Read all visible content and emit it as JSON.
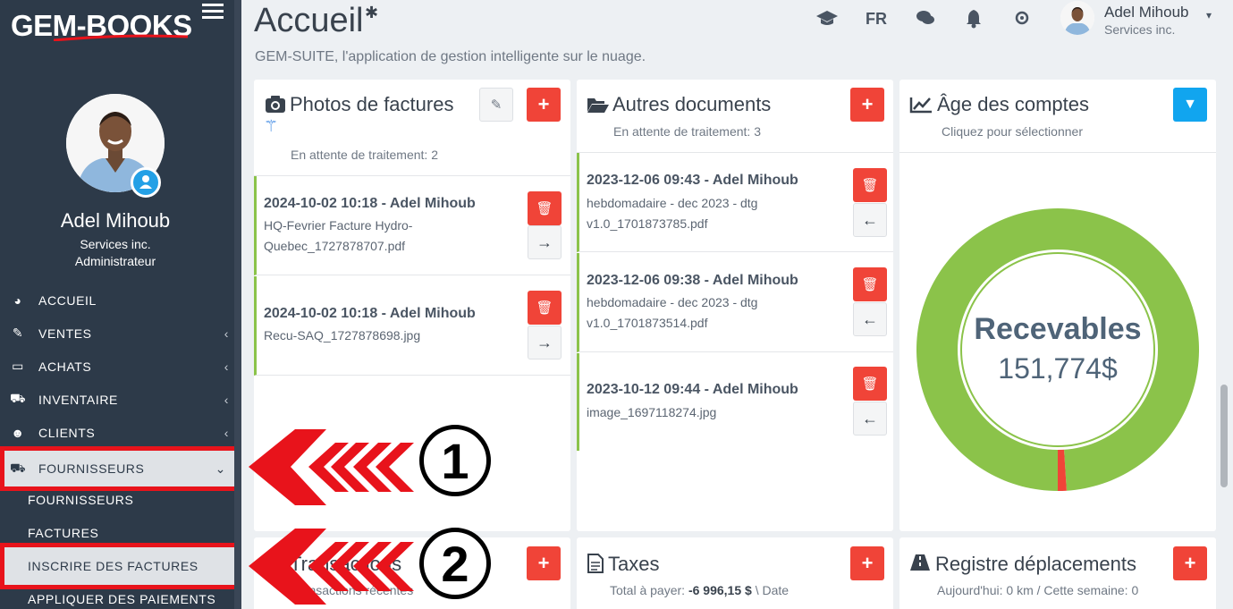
{
  "brand": {
    "logo_text": "GEM-BOOKS"
  },
  "profile": {
    "name": "Adel Mihoub",
    "company": "Services inc.",
    "role": "Administrateur"
  },
  "nav": {
    "accueil": "ACCUEIL",
    "ventes": "VENTES",
    "achats": "ACHATS",
    "inventaire": "INVENTAIRE",
    "clients": "CLIENTS",
    "fournisseurs": "FOURNISSEURS",
    "sub_fournisseurs": "FOURNISSEURS",
    "sub_factures": "FACTURES",
    "sub_inscrire": "INSCRIRE DES FACTURES",
    "sub_paiements": "APPLIQUER DES PAIEMENTS"
  },
  "header": {
    "title": "Accueil",
    "subtitle": "GEM-SUITE, l'application de gestion intelligente sur le nuage.",
    "lang": "FR",
    "user_name": "Adel Mihoub",
    "user_company": "Services inc."
  },
  "photos_card": {
    "title": "Photos de factures",
    "pending": "En attente de traitement: 2",
    "items": [
      {
        "title": "2024-10-02 10:18 - Adel Mihoub",
        "line1": "HQ-Fevrier Facture Hydro-",
        "line2": "Quebec_1727878707.pdf"
      },
      {
        "title": "2024-10-02 10:18 - Adel Mihoub",
        "line1": "Recu-SAQ_1727878698.jpg",
        "line2": ""
      }
    ]
  },
  "docs_card": {
    "title": "Autres documents",
    "pending": "En attente de traitement: 3",
    "items": [
      {
        "title": "2023-12-06 09:43 - Adel Mihoub",
        "line1": "hebdomadaire - dec 2023 - dtg",
        "line2": "v1.0_1701873785.pdf"
      },
      {
        "title": "2023-12-06 09:38 - Adel Mihoub",
        "line1": "hebdomadaire - dec 2023 - dtg",
        "line2": "v1.0_1701873514.pdf"
      },
      {
        "title": "2023-10-12 09:44 - Adel Mihoub",
        "line1": "image_1697118274.jpg",
        "line2": ""
      }
    ]
  },
  "age_card": {
    "title": "Âge des comptes",
    "subtitle": "Cliquez pour sélectionner",
    "center_label": "Recevables",
    "center_value": "151,774$",
    "colors": {
      "current": "#8bc34a",
      "overdue": "#f04438"
    },
    "overdue_fraction": 0.01
  },
  "transactions_card": {
    "title": "Transactions",
    "subtitle": "Transactions récentes"
  },
  "taxes_card": {
    "title": "Taxes",
    "label": "Total à payer:",
    "amount": "-6 996,15 $",
    "suffix": "\\ Date"
  },
  "registre_card": {
    "title": "Registre déplacements",
    "subtitle": "Aujourd'hui: 0 km / Cette semaine: 0"
  },
  "annotations": {
    "step1": "1",
    "step2": "2"
  }
}
